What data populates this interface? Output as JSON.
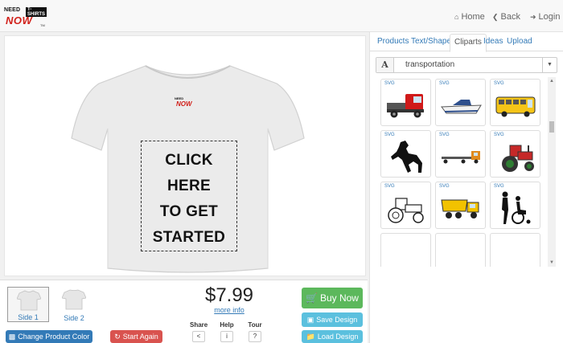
{
  "brand": {
    "line1": "NEED",
    "line1b": "T-SHIRTS",
    "line2": "NOW",
    "tm": "TM"
  },
  "nav": {
    "home": "Home",
    "back": "Back",
    "login": "Login"
  },
  "design": {
    "line1": "CLICK HERE",
    "line2": "TO GET",
    "line3": "STARTED",
    "shirt_color": "#e9e9e9"
  },
  "sides": [
    {
      "label": "Side 1",
      "selected": true
    },
    {
      "label": "Side 2",
      "selected": false
    }
  ],
  "price": {
    "value": "$7.99",
    "more_info": "more info"
  },
  "tools": {
    "share": "Share",
    "help": "Help",
    "tour": "Tour"
  },
  "buttons": {
    "buy_now": "Buy Now",
    "save_design": "Save Design",
    "load_design": "Load Design",
    "change_color": "Change Product Color",
    "start_again": "Start Again"
  },
  "colors": {
    "buy": "#5cb85c",
    "info": "#5bc0de",
    "primary": "#337ab7",
    "danger": "#d9534f"
  },
  "tabs": [
    "Products",
    "Text/Shapes",
    "Cliparts",
    "Ideas",
    "Upload"
  ],
  "active_tab": "Cliparts",
  "clipart_search": {
    "category": "transportation",
    "font_icon": "A"
  },
  "cliparts": [
    {
      "tag": "SVG",
      "icon": "semi-truck-icon"
    },
    {
      "tag": "SVG",
      "icon": "speedboat-icon"
    },
    {
      "tag": "SVG",
      "icon": "school-bus-icon"
    },
    {
      "tag": "SVG",
      "icon": "horse-silhouette-icon"
    },
    {
      "tag": "SVG",
      "icon": "flatbed-truck-icon"
    },
    {
      "tag": "SVG",
      "icon": "red-tractor-icon"
    },
    {
      "tag": "SVG",
      "icon": "tractor-outline-icon"
    },
    {
      "tag": "SVG",
      "icon": "dump-truck-icon"
    },
    {
      "tag": "SVG",
      "icon": "wheelchair-icon"
    }
  ]
}
